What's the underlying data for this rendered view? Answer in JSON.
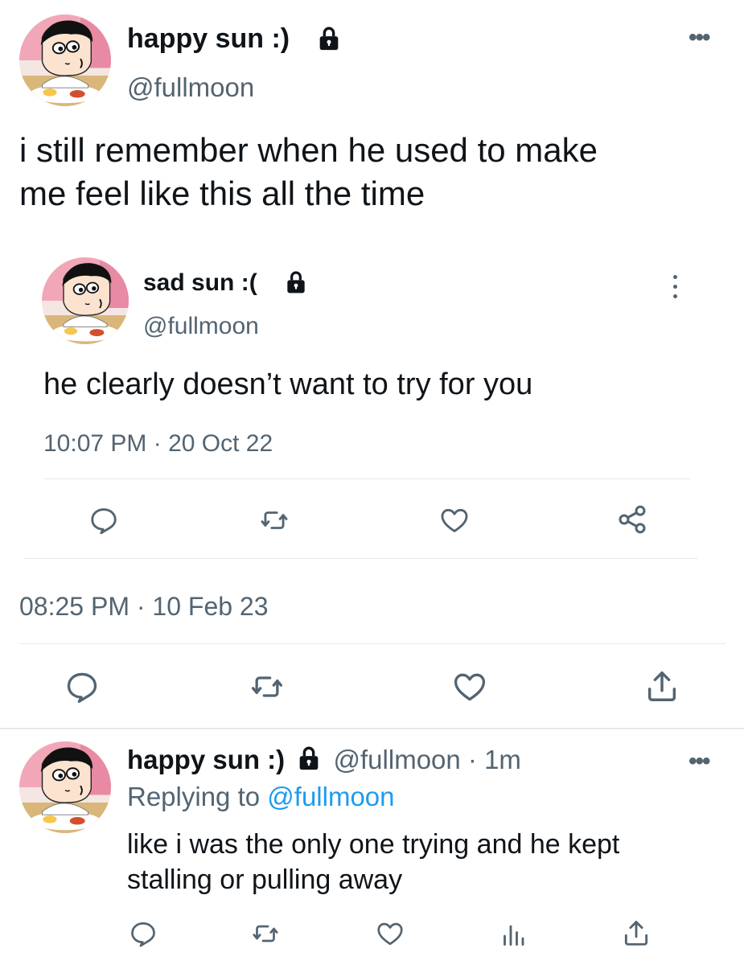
{
  "main_tweet": {
    "display_name": "happy sun :)",
    "handle": "@fullmoon",
    "text_line1": "i still remember when he used to make",
    "text_line2": "me feel like this all the time"
  },
  "quoted_tweet": {
    "display_name": "sad sun :(",
    "handle": "@fullmoon",
    "text": "he clearly doesn’t want to try for you",
    "timestamp": "10:07 PM · 20 Oct 22"
  },
  "main_timestamp": "08:25 PM · 10 Feb 23",
  "reply_tweet": {
    "display_name": "happy sun :)",
    "handle_time": "@fullmoon · 1m",
    "replying_prefix": "Replying to",
    "replying_handle": "@fullmoon",
    "text_line1": "like i was the only one trying and he kept",
    "text_line2": "stalling or pulling away"
  },
  "icons": {
    "more": "more-icon",
    "lock": "lock-icon",
    "reply": "reply-icon",
    "retweet": "retweet-icon",
    "like": "heart-icon",
    "share": "share-icon",
    "analytics": "analytics-icon"
  },
  "colors": {
    "text": "#0f1419",
    "secondary": "#536471",
    "link": "#1d9bf0",
    "divider": "#e6e9ec"
  }
}
